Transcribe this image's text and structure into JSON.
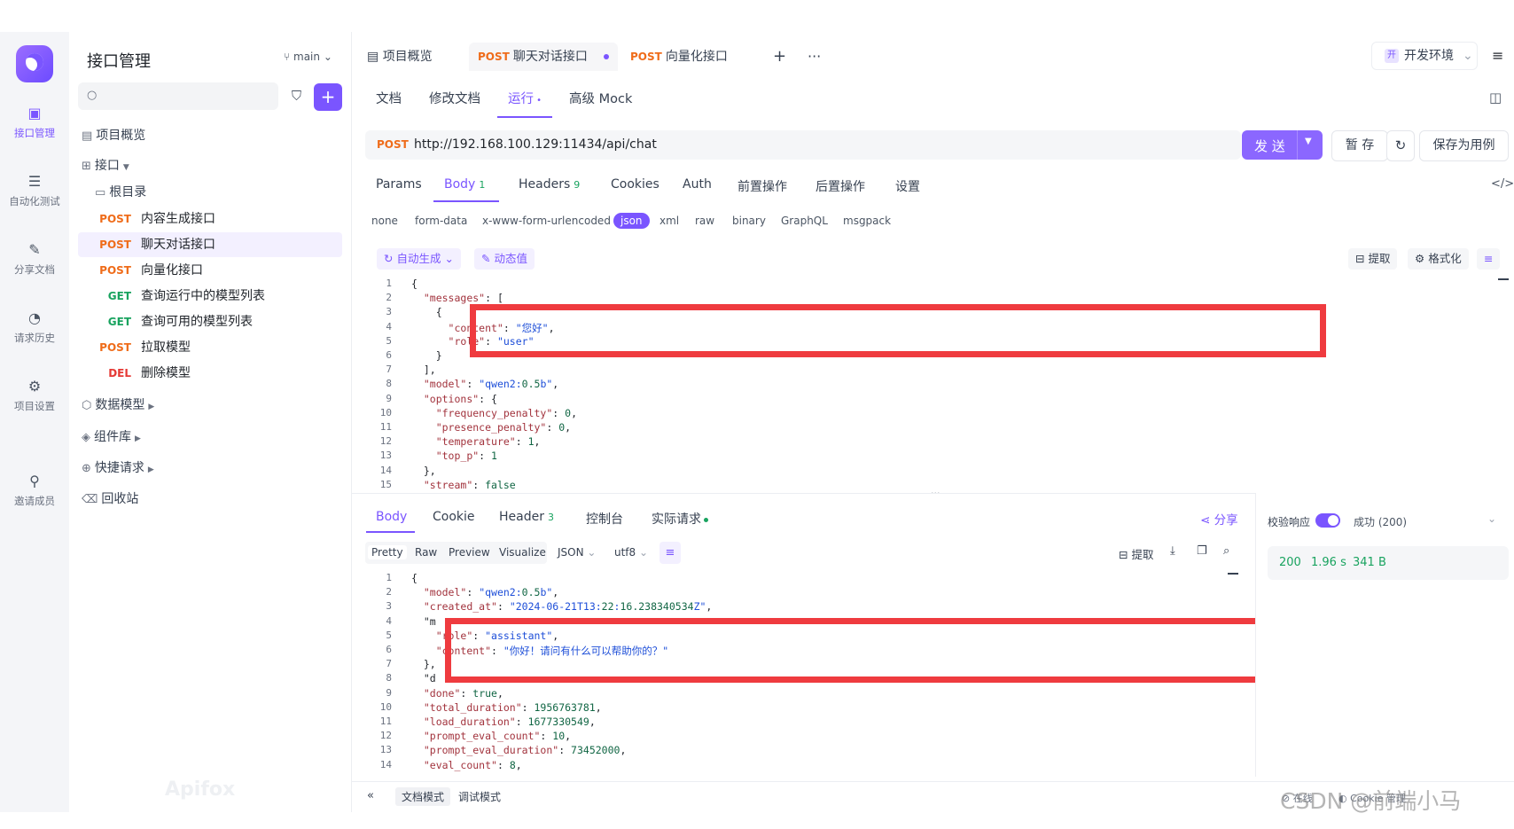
{
  "rail": {
    "items": [
      {
        "label": "接口管理",
        "icon": "api-icon",
        "active": true
      },
      {
        "label": "自动化测试",
        "icon": "automation-icon",
        "active": false
      },
      {
        "label": "分享文档",
        "icon": "share-doc-icon",
        "active": false
      },
      {
        "label": "请求历史",
        "icon": "history-icon",
        "active": false
      },
      {
        "label": "项目设置",
        "icon": "settings-icon",
        "active": false
      },
      {
        "label": "邀请成员",
        "icon": "invite-icon",
        "active": false
      }
    ]
  },
  "sidebar": {
    "title": "接口管理",
    "branch": "main",
    "overview": "项目概览",
    "interfaces": "接口",
    "root": "根目录",
    "apis": [
      {
        "method": "POST",
        "name": "内容生成接口"
      },
      {
        "method": "POST",
        "name": "聊天对话接口"
      },
      {
        "method": "POST",
        "name": "向量化接口"
      },
      {
        "method": "GET",
        "name": "查询运行中的模型列表"
      },
      {
        "method": "GET",
        "name": "查询可用的模型列表"
      },
      {
        "method": "POST",
        "name": "拉取模型"
      },
      {
        "method": "DEL",
        "name": "删除模型"
      }
    ],
    "sections": [
      "数据模型",
      "组件库",
      "快捷请求",
      "回收站"
    ],
    "watermark": "Apifox"
  },
  "tabs": {
    "overview": "项目概览",
    "tab1_method": "POST",
    "tab1_name": "聊天对话接口",
    "tab2_method": "POST",
    "tab2_name": "向量化接口",
    "env_badge": "开",
    "env": "开发环境"
  },
  "subtabs": [
    "文档",
    "修改文档",
    "运行",
    "高级 Mock"
  ],
  "request": {
    "method": "POST",
    "url": "http://192.168.100.129:11434/api/chat",
    "send": "发 送",
    "save_temp": "暂 存",
    "save_case": "保存为用例",
    "tabs": [
      {
        "label": "Params",
        "count": ""
      },
      {
        "label": "Body",
        "count": "1"
      },
      {
        "label": "Headers",
        "count": "9"
      },
      {
        "label": "Cookies",
        "count": ""
      },
      {
        "label": "Auth",
        "count": ""
      },
      {
        "label": "前置操作",
        "count": ""
      },
      {
        "label": "后置操作",
        "count": ""
      },
      {
        "label": "设置",
        "count": ""
      }
    ],
    "body_types": [
      "none",
      "form-data",
      "x-www-form-urlencoded",
      "json",
      "xml",
      "raw",
      "binary",
      "GraphQL",
      "msgpack"
    ],
    "auto_gen": "自动生成",
    "dynamic": "动态值",
    "extract": "提取",
    "format": "格式化",
    "code_lines": [
      "{",
      "  \"messages\": [",
      "    {",
      "      \"content\": \"您好\",",
      "      \"role\": \"user\"",
      "    }",
      "  ],",
      "  \"model\": \"qwen2:0.5b\",",
      "  \"options\": {",
      "    \"frequency_penalty\": 0,",
      "    \"presence_penalty\": 0,",
      "    \"temperature\": 1,",
      "    \"top_p\": 1",
      "  },",
      "  \"stream\": false"
    ]
  },
  "response": {
    "tabs": [
      {
        "label": "Body",
        "count": ""
      },
      {
        "label": "Cookie",
        "count": ""
      },
      {
        "label": "Header",
        "count": "3"
      },
      {
        "label": "控制台",
        "count": ""
      },
      {
        "label": "实际请求",
        "count": ""
      }
    ],
    "share": "分享",
    "views": [
      "Pretty",
      "Raw",
      "Preview",
      "Visualize"
    ],
    "format": "JSON",
    "encoding": "utf8",
    "extract": "提取",
    "validate": "校验响应",
    "result": "成功 (200)",
    "status": "200",
    "time": "1.96 s",
    "size": "341 B",
    "code_lines": [
      "{",
      "  \"model\": \"qwen2:0.5b\",",
      "  \"created_at\": \"2024-06-21T13:22:16.238340534Z\",",
      "  \"m",
      "    \"role\": \"assistant\",",
      "    \"content\": \"你好！请问有什么可以帮助你的？\"",
      "  },",
      "  \"d",
      "  \"done\": true,",
      "  \"total_duration\": 1956763781,",
      "  \"load_duration\": 1677330549,",
      "  \"prompt_eval_count\": 10,",
      "  \"prompt_eval_duration\": 73452000,",
      "  \"eval_count\": 8,"
    ]
  },
  "bottom": {
    "doc_mode": "文档模式",
    "debug_mode": "调试模式",
    "online": "在线",
    "cookie": "Cookie 管理",
    "csdn": "CSDN @前端小马"
  }
}
